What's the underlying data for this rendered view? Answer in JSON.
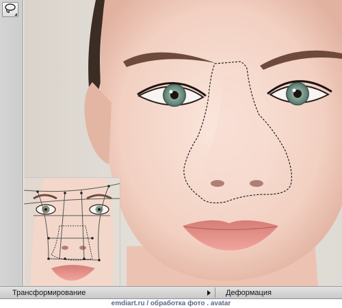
{
  "toolbar": {
    "lasso_tool": {
      "icon": "lasso-icon"
    }
  },
  "bottom_bar": {
    "left_label": "Трансформирование",
    "right_label": "Деформация"
  },
  "footer": {
    "site": "emdiart.ru",
    "caption": "/ обработка фото . avatar"
  },
  "colors": {
    "skin_light": "#f6d9cf",
    "skin_shadow": "#e1b6a6",
    "background": "#dcdcd6",
    "lips": "#e7948c",
    "hair": "#3a2a22",
    "iris": "#7a9a8c",
    "selection_line": "#111111",
    "bar": "#d6d6d6"
  }
}
